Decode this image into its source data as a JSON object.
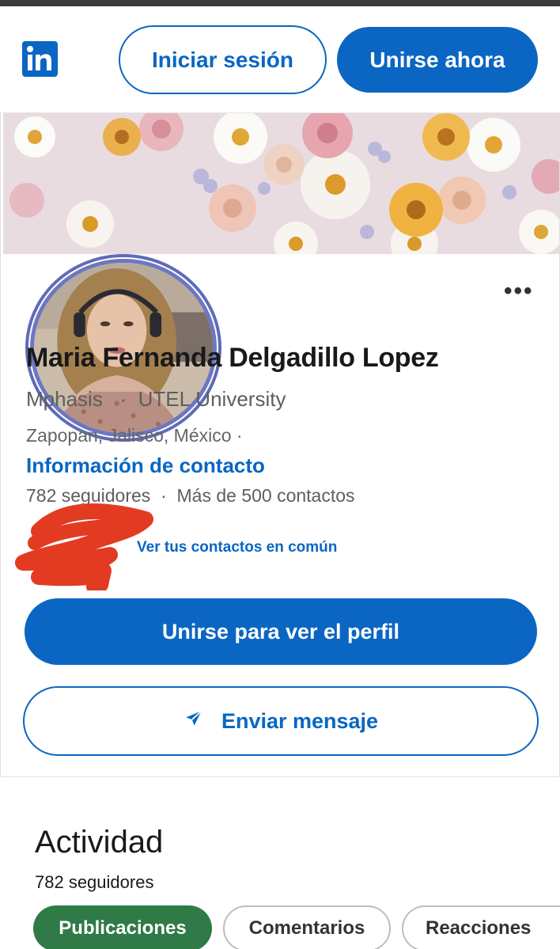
{
  "header": {
    "logo_text": "in",
    "login_label": "Iniciar sesión",
    "join_label": "Unirse ahora"
  },
  "profile": {
    "name": "Maria Fernanda Delgadillo Lopez",
    "headline": "Mphasis   ·  UTEL University",
    "location": "Zapopan, Jalisco, México  ·",
    "contact_info_label": "Información de contacto",
    "counts": "782 seguidores  ·  Más de 500 contactos",
    "mutual_label": "Ver tus contactos en común",
    "more_icon": "more-horizontal-icon"
  },
  "actions": {
    "view_profile_label": "Unirse para ver el perfil",
    "send_message_label": "Enviar mensaje",
    "send_icon": "paper-plane-icon"
  },
  "activity": {
    "title": "Actividad",
    "followers": "782 seguidores",
    "tabs": [
      {
        "label": "Publicaciones",
        "active": true
      },
      {
        "label": "Comentarios",
        "active": false
      },
      {
        "label": "Reacciones",
        "active": false
      }
    ]
  },
  "colors": {
    "brand_blue": "#0a66c2",
    "active_tab_green": "#2f7a46",
    "redaction_red": "#e23b22"
  }
}
